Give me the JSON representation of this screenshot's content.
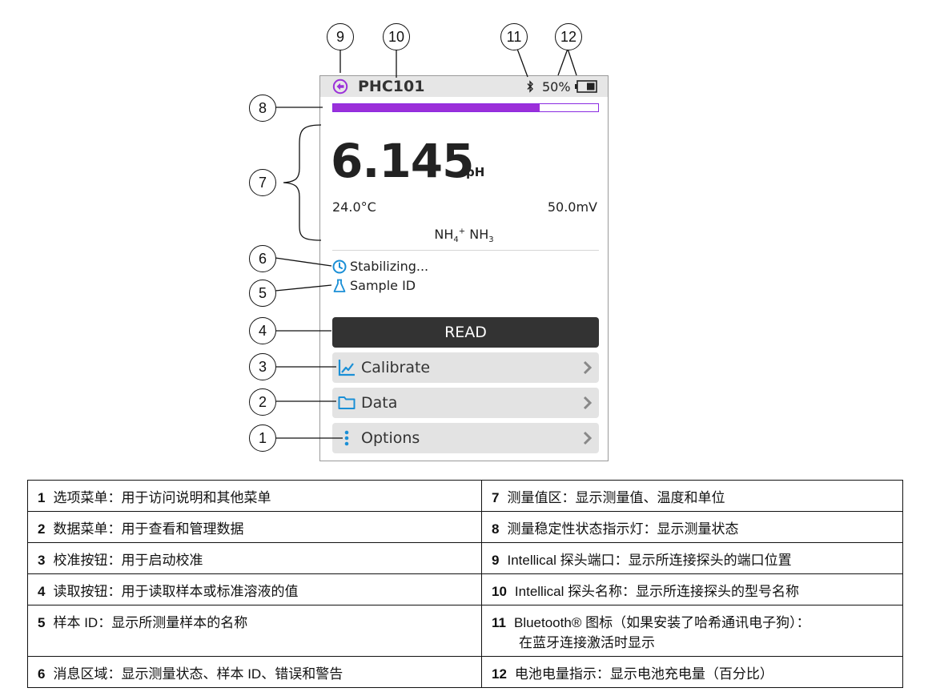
{
  "screen": {
    "probe_name": "PHC101",
    "battery_percent": "50%",
    "stability_progress": 0.78,
    "reading": {
      "value": "6.145",
      "unit": "pH",
      "temperature": "24.0°C",
      "millivolts": "50.0mV",
      "species": {
        "a": "NH",
        "a_sub": "4",
        "a_sup": "+",
        "b": "NH",
        "b_sub": "3"
      }
    },
    "messages": {
      "status": "Stabilizing...",
      "sample_id": "Sample ID"
    },
    "buttons": {
      "read": "READ",
      "calibrate": "Calibrate",
      "data": "Data",
      "options": "Options"
    },
    "colors": {
      "accent_purple": "#9b30d9",
      "icon_blue": "#1a8fd6",
      "read_button": "#333333",
      "menu_button": "#e3e3e3"
    }
  },
  "callouts": [
    "1",
    "2",
    "3",
    "4",
    "5",
    "6",
    "7",
    "8",
    "9",
    "10",
    "11",
    "12"
  ],
  "legend": {
    "rows": [
      {
        "left": {
          "num": "1",
          "text": "选项菜单：用于访问说明和其他菜单"
        },
        "right": {
          "num": "7",
          "text": "测量值区：显示测量值、温度和单位"
        }
      },
      {
        "left": {
          "num": "2",
          "text": "数据菜单：用于查看和管理数据"
        },
        "right": {
          "num": "8",
          "text": "测量稳定性状态指示灯：显示测量状态"
        }
      },
      {
        "left": {
          "num": "3",
          "text": "校准按钮：用于启动校准"
        },
        "right": {
          "num": "9",
          "text": "Intellical 探头端口：显示所连接探头的端口位置"
        }
      },
      {
        "left": {
          "num": "4",
          "text": "读取按钮：用于读取样本或标准溶液的值"
        },
        "right": {
          "num": "10",
          "text": "Intellical 探头名称：显示所连接探头的型号名称"
        }
      },
      {
        "left": {
          "num": "5",
          "text": "样本 ID：显示所测量样本的名称"
        },
        "right": {
          "num": "11",
          "text": "Bluetooth® 图标（如果安装了哈希通讯电子狗）：",
          "text2": "在蓝牙连接激活时显示"
        }
      },
      {
        "left": {
          "num": "6",
          "text": "消息区域：显示测量状态、样本 ID、错误和警告"
        },
        "right": {
          "num": "12",
          "text": "电池电量指示：显示电池充电量（百分比）"
        }
      }
    ]
  }
}
